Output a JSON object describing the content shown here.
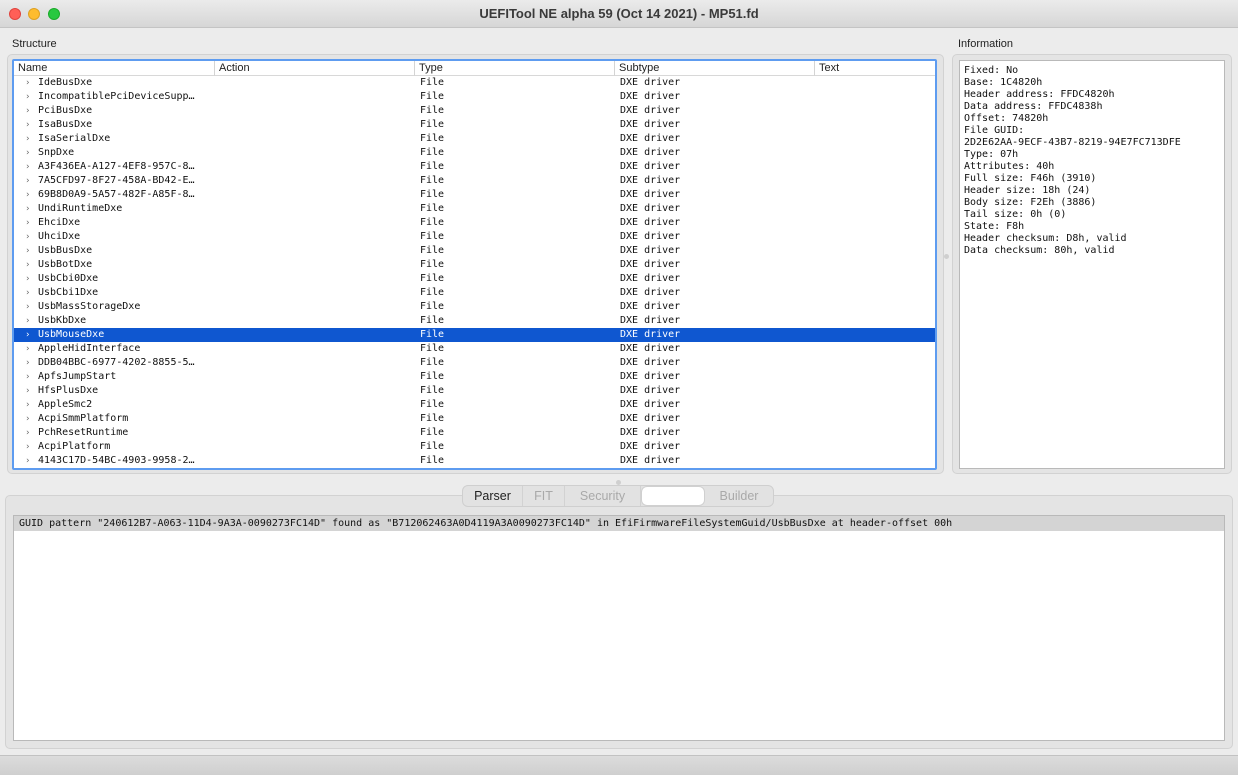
{
  "window": {
    "title": "UEFITool NE alpha 59 (Oct 14 2021) - MP51.fd"
  },
  "structure": {
    "label": "Structure",
    "columns": [
      "Name",
      "Action",
      "Type",
      "Subtype",
      "Text"
    ],
    "rows": [
      {
        "name": "IdeBusDxe",
        "type": "File",
        "subtype": "DXE driver"
      },
      {
        "name": "IncompatiblePciDeviceSupp…",
        "type": "File",
        "subtype": "DXE driver"
      },
      {
        "name": "PciBusDxe",
        "type": "File",
        "subtype": "DXE driver"
      },
      {
        "name": "IsaBusDxe",
        "type": "File",
        "subtype": "DXE driver"
      },
      {
        "name": "IsaSerialDxe",
        "type": "File",
        "subtype": "DXE driver"
      },
      {
        "name": "SnpDxe",
        "type": "File",
        "subtype": "DXE driver"
      },
      {
        "name": "A3F436EA-A127-4EF8-957C-8…",
        "type": "File",
        "subtype": "DXE driver"
      },
      {
        "name": "7A5CFD97-8F27-458A-BD42-E…",
        "type": "File",
        "subtype": "DXE driver"
      },
      {
        "name": "69B8D0A9-5A57-482F-A85F-8…",
        "type": "File",
        "subtype": "DXE driver"
      },
      {
        "name": "UndiRuntimeDxe",
        "type": "File",
        "subtype": "DXE driver"
      },
      {
        "name": "EhciDxe",
        "type": "File",
        "subtype": "DXE driver"
      },
      {
        "name": "UhciDxe",
        "type": "File",
        "subtype": "DXE driver"
      },
      {
        "name": "UsbBusDxe",
        "type": "File",
        "subtype": "DXE driver"
      },
      {
        "name": "UsbBotDxe",
        "type": "File",
        "subtype": "DXE driver"
      },
      {
        "name": "UsbCbi0Dxe",
        "type": "File",
        "subtype": "DXE driver"
      },
      {
        "name": "UsbCbi1Dxe",
        "type": "File",
        "subtype": "DXE driver"
      },
      {
        "name": "UsbMassStorageDxe",
        "type": "File",
        "subtype": "DXE driver"
      },
      {
        "name": "UsbKbDxe",
        "type": "File",
        "subtype": "DXE driver"
      },
      {
        "name": "UsbMouseDxe",
        "type": "File",
        "subtype": "DXE driver",
        "selected": true
      },
      {
        "name": "AppleHidInterface",
        "type": "File",
        "subtype": "DXE driver"
      },
      {
        "name": "DDB04BBC-6977-4202-8855-5…",
        "type": "File",
        "subtype": "DXE driver"
      },
      {
        "name": "ApfsJumpStart",
        "type": "File",
        "subtype": "DXE driver"
      },
      {
        "name": "HfsPlusDxe",
        "type": "File",
        "subtype": "DXE driver"
      },
      {
        "name": "AppleSmc2",
        "type": "File",
        "subtype": "DXE driver"
      },
      {
        "name": "AcpiSmmPlatform",
        "type": "File",
        "subtype": "DXE driver"
      },
      {
        "name": "PchResetRuntime",
        "type": "File",
        "subtype": "DXE driver"
      },
      {
        "name": "AcpiPlatform",
        "type": "File",
        "subtype": "DXE driver"
      },
      {
        "name": "4143C17D-54BC-4903-9958-2…",
        "type": "File",
        "subtype": "DXE driver"
      }
    ],
    "chevron_icon": "chevron-right-icon"
  },
  "information": {
    "label": "Information",
    "lines": [
      "Fixed: No",
      "Base: 1C4820h",
      "Header address: FFDC4820h",
      "Data address: FFDC4838h",
      "Offset: 74820h",
      "File GUID:",
      "2D2E62AA-9ECF-43B7-8219-94E7FC713DFE",
      "Type: 07h",
      "Attributes: 40h",
      "Full size: F46h (3910)",
      "Header size: 18h (24)",
      "Body size: F2Eh (3886)",
      "Tail size: 0h (0)",
      "State: F8h",
      "Header checksum: D8h, valid",
      "Data checksum: 80h, valid"
    ]
  },
  "bottom_tabs": [
    {
      "label": "Parser",
      "state": "active"
    },
    {
      "label": "FIT",
      "state": "disabled"
    },
    {
      "label": "Security",
      "state": "disabled"
    },
    {
      "label": "",
      "state": "blank"
    },
    {
      "label": "Builder",
      "state": "disabled"
    }
  ],
  "messages": [
    "GUID pattern \"240612B7-A063-11D4-9A3A-0090273FC14D\" found as \"B712062463A0D4119A3A0090273FC14D\" in EfiFirmwareFileSystemGuid/UsbBusDxe at header-offset 00h"
  ],
  "colors": {
    "selection": "#0f57d0",
    "focus_ring": "#5e9cf0",
    "close": "#ff5f57",
    "minimize": "#febc2e",
    "maximize": "#28c840"
  }
}
